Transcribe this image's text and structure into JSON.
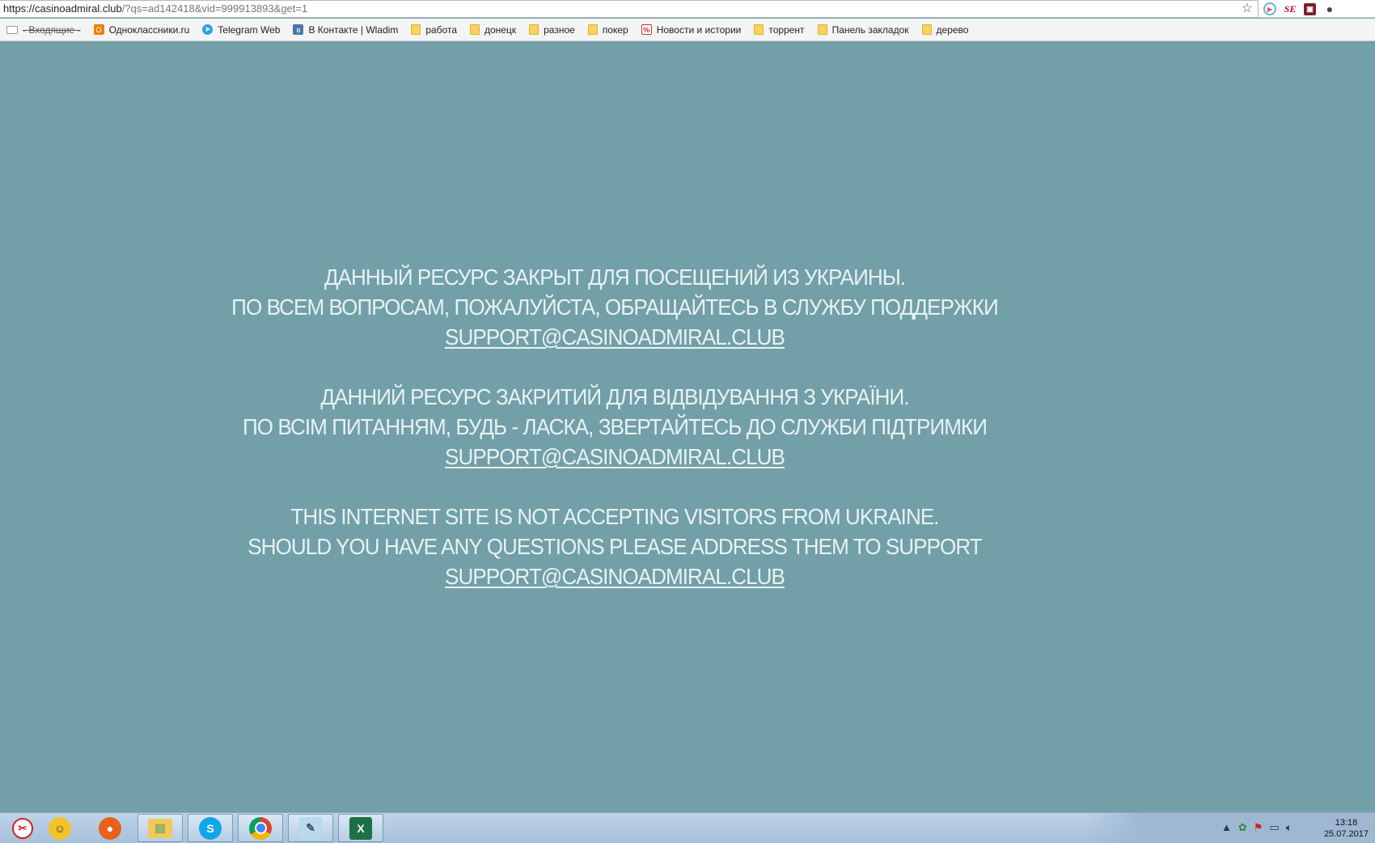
{
  "browser": {
    "url_host": "https://casinoadmiral.club",
    "url_rest": "/?qs=ad142418&vid=999913893&get=1",
    "extensions": [
      "play-extension-icon",
      "se-extension-icon",
      "red-extension-icon",
      "user-profile-icon"
    ]
  },
  "bookmarks": [
    {
      "label": "- Входящие -",
      "icon": "mail-icon"
    },
    {
      "label": "Одноклассники.ru",
      "icon": "odnoklassniki-icon"
    },
    {
      "label": "Telegram Web",
      "icon": "telegram-icon"
    },
    {
      "label": "В Контакте | Wladim",
      "icon": "vk-icon"
    },
    {
      "label": "работа",
      "icon": "folder-icon"
    },
    {
      "label": "донецк",
      "icon": "folder-icon"
    },
    {
      "label": "разное",
      "icon": "folder-icon"
    },
    {
      "label": "покер",
      "icon": "folder-icon"
    },
    {
      "label": "Новости и истории",
      "icon": "percent-icon"
    },
    {
      "label": "торрент",
      "icon": "folder-icon"
    },
    {
      "label": "Панель закладок",
      "icon": "folder-icon"
    },
    {
      "label": "дерево",
      "icon": "folder-icon"
    }
  ],
  "messages": {
    "ru": {
      "line1": "ДАННЫЙ РЕСУРС ЗАКРЫТ ДЛЯ ПОСЕЩЕНИЙ ИЗ УКРАИНЫ.",
      "line2": "ПО ВСЕМ ВОПРОСАМ, ПОЖАЛУЙСТА, ОБРАЩАЙТЕСЬ В СЛУЖБУ ПОДДЕРЖКИ",
      "email": "SUPPORT@CASINOADMIRAL.CLUB"
    },
    "ua": {
      "line1": "ДАННИЙ РЕСУРС ЗАКРИТИЙ ДЛЯ ВІДВІДУВАННЯ З УКРАЇНИ.",
      "line2": "ПО ВСІМ ПИТАННЯМ, БУДЬ - ЛАСКА, ЗВЕРТАЙТЕСЬ ДО СЛУЖБИ ПІДТРИМКИ",
      "email": "SUPPORT@CASINOADMIRAL.CLUB"
    },
    "en": {
      "line1": "THIS INTERNET SITE IS NOT ACCEPTING VISITORS FROM UKRAINE.",
      "line2": "SHOULD YOU HAVE ANY QUESTIONS PLEASE ADDRESS THEM TO SUPPORT",
      "email": "SUPPORT@CASINOADMIRAL.CLUB"
    }
  },
  "colors": {
    "page_background": "#729fa8",
    "message_text": "#e7f3f2"
  },
  "taskbar": {
    "apps": [
      "snipping-tool-icon",
      "messenger-icon",
      "firefox-icon",
      "file-explorer-icon",
      "skype-icon",
      "chrome-icon",
      "notepad-icon",
      "excel-icon"
    ],
    "time": "13:18",
    "date": "25.07.2017"
  }
}
